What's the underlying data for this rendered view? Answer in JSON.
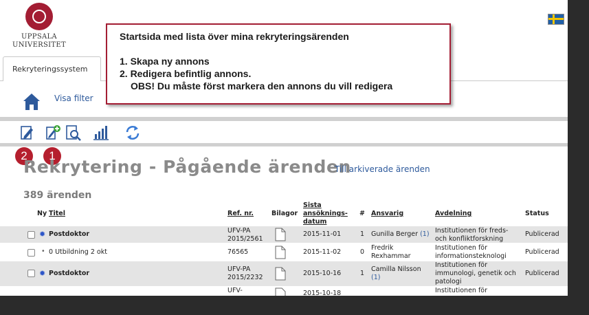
{
  "header": {
    "logo_line1": "UPPSALA",
    "logo_line2": "UNIVERSITET",
    "language_flag": "swedish-flag-icon"
  },
  "tabs": [
    {
      "label": "Rekryteringssystem"
    }
  ],
  "nav": {
    "visa_filter": "Visa filter"
  },
  "callout": {
    "title": "Startsida med lista över mina rekryteringsärenden",
    "item1": "1. Skapa ny annons",
    "item2": "2. Redigera befintlig annons.",
    "note": "OBS! Du måste först markera den annons du vill redigera"
  },
  "badges": {
    "edit": "2",
    "new": "1"
  },
  "toolbar_icons": [
    "edit-icon",
    "add-icon",
    "search-icon",
    "chart-icon",
    "refresh-icon"
  ],
  "main": {
    "heading": "Rekrytering - Pågående ärenden",
    "archived_link": "Till arkiverade ärenden",
    "count": "389 ärenden"
  },
  "columns": {
    "ny": "Ny",
    "titel": "Titel",
    "ref": "Ref. nr.",
    "bilagor": "Bilagor",
    "sista1": "Sista",
    "sista2": "ansöknings-",
    "sista3": "datum",
    "hash": "#",
    "ansvarig": "Ansvarig",
    "avdelning": "Avdelning",
    "status": "Status"
  },
  "rows": [
    {
      "title": "Postdoktor",
      "marker": "✹",
      "ref1": "UFV-PA",
      "ref2": "2015/2561",
      "date": "2015-11-01",
      "num": "1",
      "ansvarig1": "Gunilla Berger",
      "ansvarig_count": "(1)",
      "ansvarig2": "",
      "avd1": "Institutionen för freds-",
      "avd2": "och konfliktforskning",
      "avd3": "",
      "status": "Publicerad"
    },
    {
      "title": "0 Utbildning 2 okt",
      "marker": "•",
      "ref1": "76565",
      "ref2": "",
      "date": "2015-11-02",
      "num": "0",
      "ansvarig1": "Fredrik",
      "ansvarig_count": "",
      "ansvarig2": "Rexhammar",
      "avd1": "Institutionen för",
      "avd2": "informationsteknologi",
      "avd3": "",
      "status": "Publicerad"
    },
    {
      "title": "Postdoktor",
      "marker": "✹",
      "ref1": "UFV-PA",
      "ref2": "2015/2232",
      "date": "2015-10-16",
      "num": "1",
      "ansvarig1": "Camilla Nilsson",
      "ansvarig_count": "(1)",
      "ansvarig2": "",
      "avd1": "Institutionen för",
      "avd2": "immunologi, genetik och",
      "avd3": "patologi",
      "status": "Publicerad"
    },
    {
      "title": "",
      "marker": "",
      "ref1": "UFV-",
      "ref2": "",
      "date": "2015-10-18",
      "num": "",
      "ansvarig1": "",
      "ansvarig_count": "",
      "ansvarig2": "",
      "avd1": "Institutionen för",
      "avd2": "",
      "avd3": "",
      "status": ""
    }
  ]
}
